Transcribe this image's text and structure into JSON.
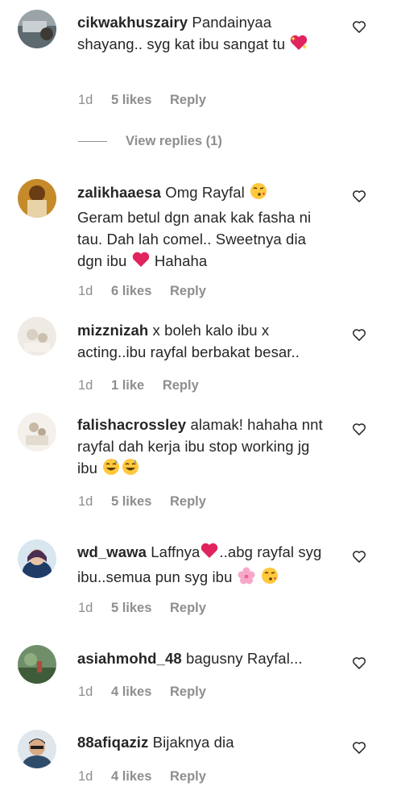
{
  "comments": [
    {
      "username": "cikwakhuszairy",
      "text": "Pandainyaa shayang.. syg kat ibu sangat tu",
      "emojis": [
        "sparkling-heart"
      ],
      "time": "1d",
      "likes": "5 likes",
      "reply": "Reply",
      "view_replies": "View replies (1)"
    },
    {
      "username": "zalikhaaesa",
      "text_a": "Omg Rayfal",
      "text_b": "Geram betul dgn anak kak fasha ni tau. Dah lah comel.. Sweetnya dia dgn ibu",
      "text_c": "Hahaha",
      "emojis": [
        "kissing-face",
        "red-heart"
      ],
      "time": "1d",
      "likes": "6 likes",
      "reply": "Reply"
    },
    {
      "username": "mizznizah",
      "text": "x boleh kalo ibu x acting..ibu rayfal berbakat besar..",
      "time": "1d",
      "likes": "1 like",
      "reply": "Reply"
    },
    {
      "username": "falishacrossley",
      "text": "alamak! hahaha nnt rayfal dah kerja ibu stop working jg ibu",
      "emojis": [
        "grinning-sweat-face",
        "grinning-sweat-face"
      ],
      "time": "1d",
      "likes": "5 likes",
      "reply": "Reply"
    },
    {
      "username": "wd_wawa",
      "text_a": "Laffnya",
      "text_b": "..abg rayfal syg ibu..semua pun syg ibu",
      "emojis": [
        "red-heart",
        "cherry-blossom",
        "kissing-face"
      ],
      "time": "1d",
      "likes": "5 likes",
      "reply": "Reply"
    },
    {
      "username": "asiahmohd_48",
      "text": "bagusny Rayfal...",
      "time": "1d",
      "likes": "4 likes",
      "reply": "Reply"
    },
    {
      "username": "88afiqaziz",
      "text": "Bijaknya dia",
      "time": "1d",
      "likes": "4 likes",
      "reply": "Reply"
    }
  ],
  "colors": {
    "text": "#262626",
    "muted": "#8e8e8e",
    "heart_red": "#e0245e"
  }
}
